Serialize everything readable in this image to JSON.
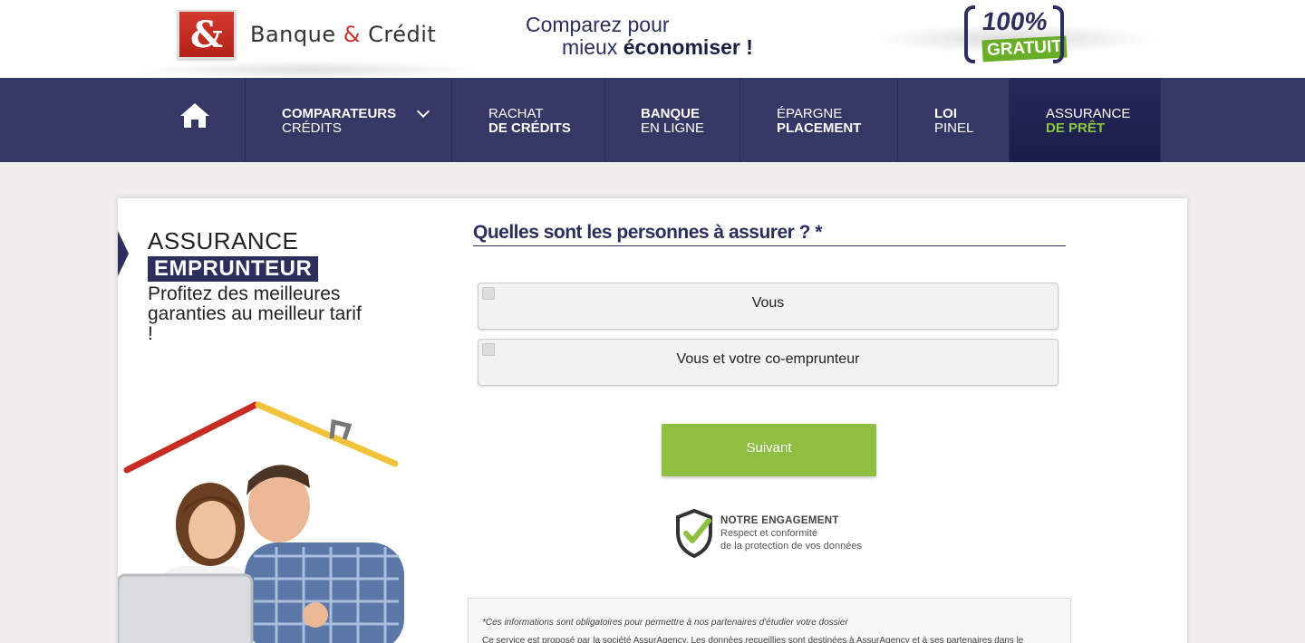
{
  "header": {
    "logo_symbol": "&",
    "brand_part1": "Banque",
    "brand_amp": "&",
    "brand_part2": "Crédit",
    "slogan_line1": "Comparez pour",
    "slogan_line2_pre": "mieux",
    "slogan_line2_bold": "économiser !",
    "badge_pct": "100%",
    "badge_text": "GRATUIT"
  },
  "nav": {
    "home_icon": "home-icon",
    "items": [
      {
        "line1": "COMPARATEURS",
        "line2": "CRÉDITS"
      },
      {
        "line1": "RACHAT",
        "line2": "DE CRÉDITS"
      },
      {
        "line1": "BANQUE",
        "line2": "EN LIGNE"
      },
      {
        "line1": "ÉPARGNE",
        "line2": "PLACEMENT"
      },
      {
        "line1": "LOI",
        "line2": "PINEL"
      },
      {
        "line1": "ASSURANCE",
        "line2": "DE PRÊT"
      }
    ]
  },
  "promo": {
    "line1": "ASSURANCE",
    "line2": "EMPRUNTEUR",
    "line3": "Profitez des meilleures garanties au meilleur tarif !"
  },
  "form": {
    "question": "Quelles sont les personnes à assurer ? *",
    "options": [
      "Vous",
      "Vous et votre co-emprunteur"
    ],
    "next_button": "Suivant"
  },
  "engagement": {
    "title": "NOTRE ENGAGEMENT",
    "line1": "Respect et conformité",
    "line2": "de la protection de vos données"
  },
  "legal": {
    "note": "*Ces informations sont obligatoires pour permettre à nos partenaires d'étudier votre dossier",
    "text": "Ce service est proposé par la société AssurAgency. Les données recueillies sont destinées à AssurAgency et à ses partenaires dans le"
  },
  "colors": {
    "navy": "#353765",
    "accent_green": "#8ebf42",
    "brand_red": "#c0342a"
  }
}
